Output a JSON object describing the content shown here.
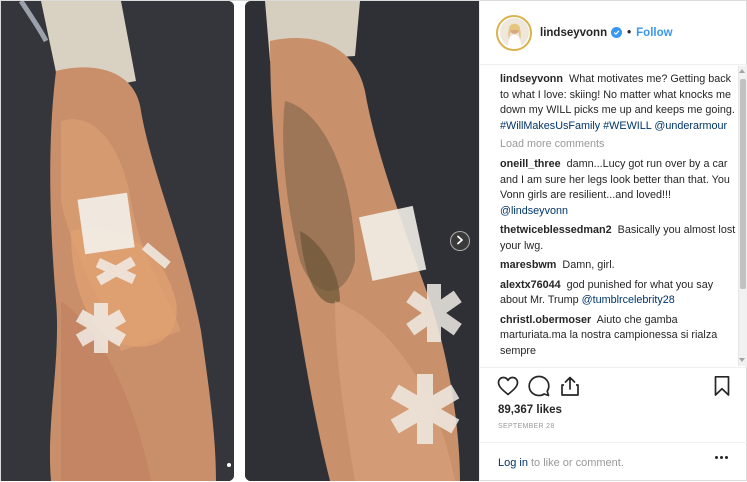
{
  "header": {
    "username": "lindseyvonn",
    "separator": "•",
    "follow_label": "Follow"
  },
  "caption": {
    "username": "lindseyvonn",
    "text": "What motivates me? Getting back to what I love: skiing! No matter what knocks me down my WILL picks me up and keeps me going.",
    "hashtags": "#WillMakesUsFamily #WEWILL",
    "mention": "@underarmour"
  },
  "load_more_label": "Load more comments",
  "comments": [
    {
      "user": "oneill_three",
      "text": "damn...Lucy got run over by a car and I am sure her legs look better than that. You Vonn girls are resilient...and loved!!!",
      "mention": "@lindseyvonn"
    },
    {
      "user": "thetwiceblessedman2",
      "text": "Basically you almost lost your lwg.",
      "mention": ""
    },
    {
      "user": "maresbwm",
      "text": "Damn, girl.",
      "mention": ""
    },
    {
      "user": "alextx76044",
      "text": "god punished for what you say about Mr. Trump",
      "mention": "@tumblrcelebrity28"
    },
    {
      "user": "christl.obermoser",
      "text": "Aiuto che gamba marturiata.ma la nostra campionessa si rialza sempre",
      "mention": ""
    }
  ],
  "likes": "89,367 likes",
  "date": "SEPTEMBER 28",
  "login": {
    "link": "Log in",
    "text": "to like or comment."
  },
  "icons": {
    "like": "heart-icon",
    "comment": "comment-bubble-icon",
    "share": "share-icon",
    "save": "bookmark-icon",
    "next": "chevron-right-icon",
    "more": "more-options-icon",
    "verified": "verified-badge-icon"
  },
  "carousel": {
    "count": 2,
    "active": 0
  },
  "colors": {
    "accent": "#3897f0",
    "link": "#003569",
    "muted": "#999999"
  }
}
